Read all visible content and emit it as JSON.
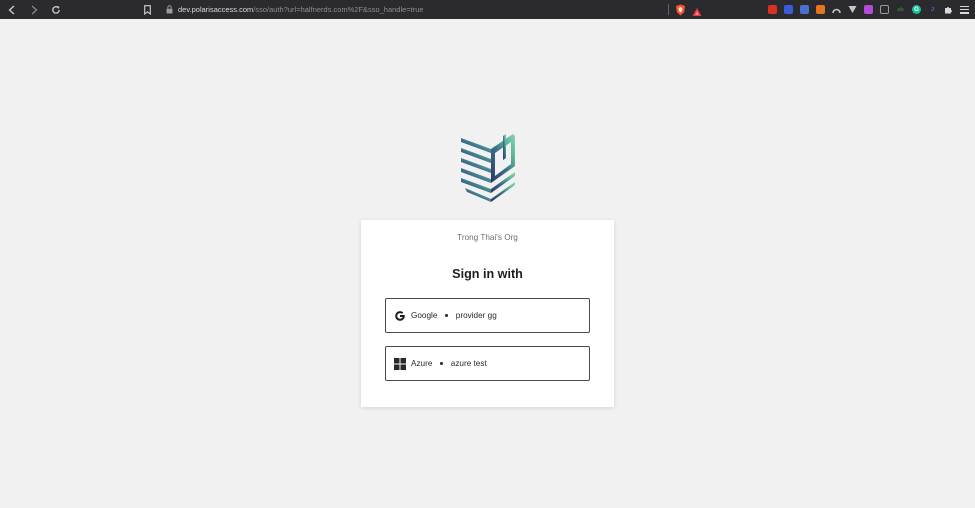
{
  "browser": {
    "url_host": "dev.polarisaccess.com",
    "url_path": "/sso/auth?url=halfnerds.com%2F&sso_handle=true",
    "extensions": [
      {
        "icon": "youtube-icon",
        "color": "#d93025",
        "label": ""
      },
      {
        "icon": "translate-icon",
        "color": "#3b5bdb",
        "label": ""
      },
      {
        "icon": "docs-icon",
        "color": "#4a6fd1",
        "label": ""
      },
      {
        "icon": "metamask-icon",
        "color": "#e2761b",
        "label": ""
      },
      {
        "icon": "arc-icon",
        "color": "#c8c8c8",
        "label": ""
      },
      {
        "icon": "vue-icon",
        "color": "#c8c8c8",
        "label": ""
      },
      {
        "icon": "picture-icon",
        "color": "#b44bd6",
        "label": ""
      },
      {
        "icon": "screenshot-icon",
        "color": "#9a9a9a",
        "label": ""
      },
      {
        "icon": "ab-icon",
        "color": "#2e7d32",
        "label": "ab"
      },
      {
        "icon": "grammarly-icon",
        "color": "#15c39a",
        "label": "G"
      },
      {
        "icon": "jira-icon",
        "color": "#3b7bd8",
        "label": "J"
      },
      {
        "icon": "puzzle-icon",
        "color": "#d8d8d8",
        "label": ""
      }
    ]
  },
  "brand": {
    "logo_colors": [
      "#2b3566",
      "#3d6f8c",
      "#5cb89a",
      "#8fd6b0"
    ]
  },
  "card": {
    "org_name": "Trong Thai's Org",
    "heading": "Sign in with",
    "providers": [
      {
        "name": "Google",
        "label": "provider gg",
        "icon": "google-icon"
      },
      {
        "name": "Azure",
        "label": "azure test",
        "icon": "windows-icon"
      }
    ]
  }
}
